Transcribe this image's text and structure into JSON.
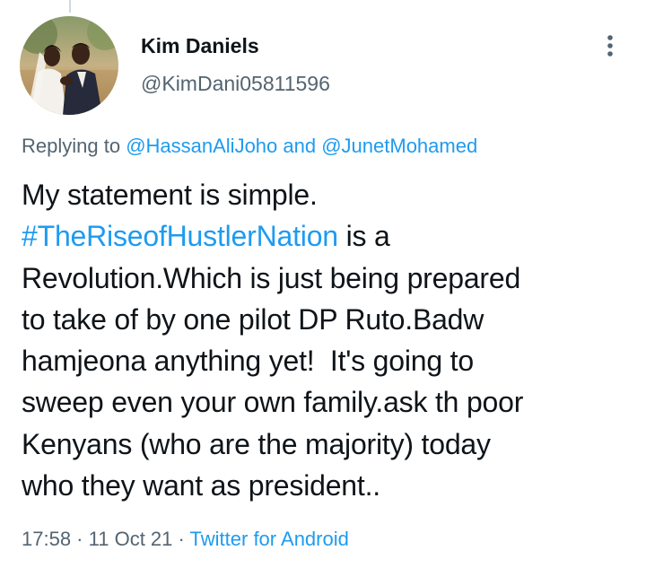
{
  "tweet": {
    "author": {
      "display_name": "Kim Daniels",
      "handle": "@KimDani05811596",
      "avatar_icon": "wedding-couple-photo"
    },
    "more_icon": "more-options-icon",
    "reply_context": {
      "prefix": "Replying to ",
      "mention_1": "@HassanAliJoho",
      "joiner": " and ",
      "mention_2": "@JunetMohamed"
    },
    "text": {
      "line_1": "My statement is simple.",
      "hashtag": "#TheRiseofHustlerNation",
      "line_2_rest": " is a",
      "line_3": "Revolution.Which is just being prepared",
      "line_4": "to take of by one pilot DP Ruto.Badw",
      "line_5": "hamjeona anything yet!  It's going to",
      "line_6": "sweep even your own family.ask th poor",
      "line_7": "Kenyans (who are the majority) today",
      "line_8": "who they want as president.."
    },
    "meta": {
      "time": "17:58",
      "separator": " · ",
      "date": "11 Oct 21",
      "source": "Twitter for Android"
    }
  },
  "colors": {
    "link": "#1d9bf0",
    "secondary_text": "#536471",
    "primary_text": "#0f1419",
    "background": "#ffffff"
  }
}
